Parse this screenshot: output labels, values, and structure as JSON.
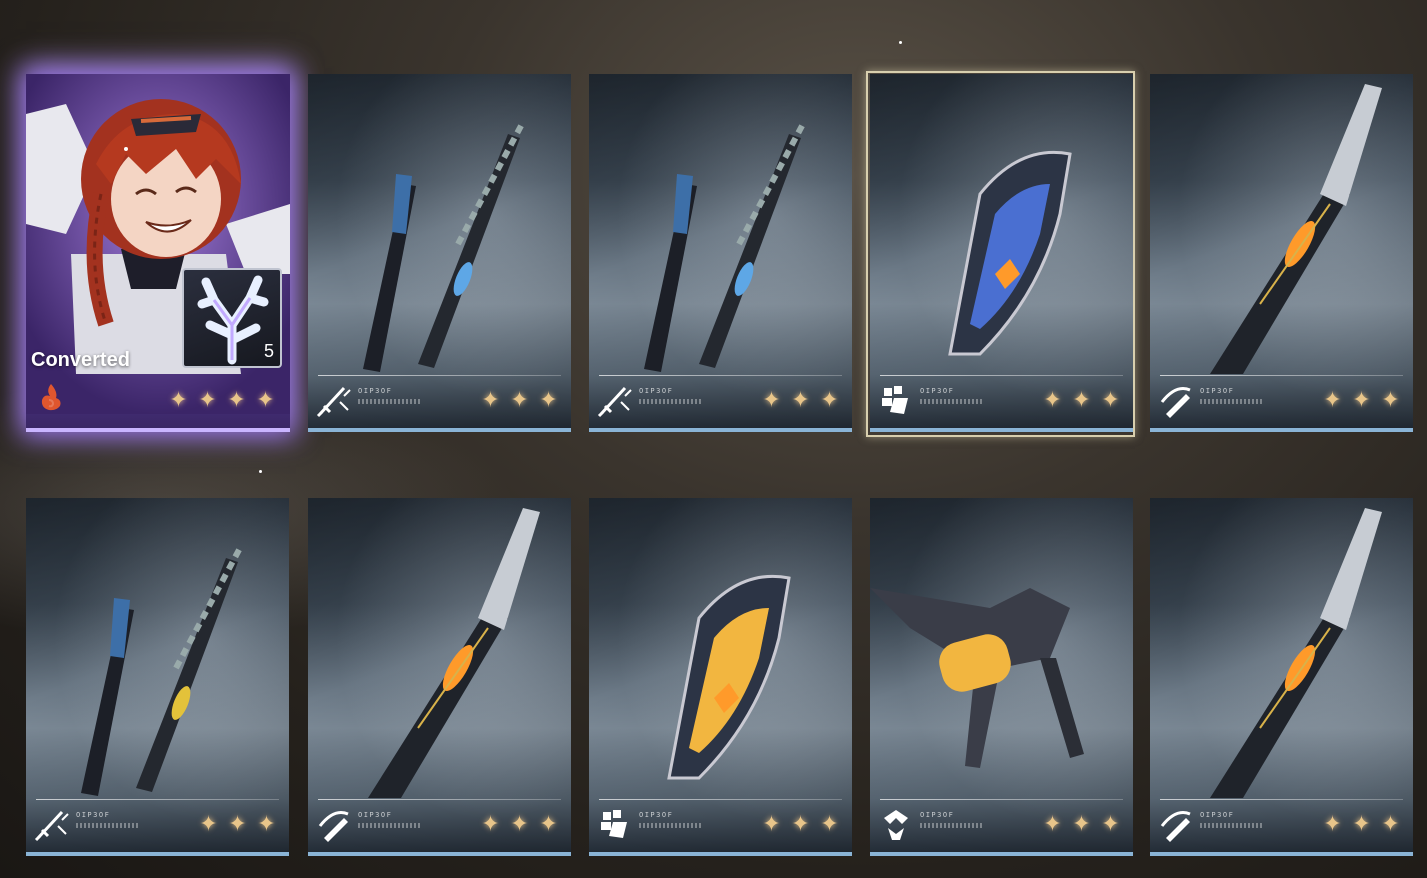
{
  "character": {
    "status_label": "Converted",
    "item_count": "5",
    "rarity": 4,
    "element_icon": "fire-element-icon",
    "item_icon": "coral-crystal-icon"
  },
  "weapons": [
    {
      "type": "sword",
      "type_icon": "sword-type-icon",
      "code": "OIP3OF",
      "rarity": 3,
      "selected": false,
      "accent": "#5ea7e6"
    },
    {
      "type": "sword",
      "type_icon": "sword-type-icon",
      "code": "OIP3OF",
      "rarity": 3,
      "selected": false,
      "accent": "#5ea7e6"
    },
    {
      "type": "gauntlet",
      "type_icon": "gauntlet-type-icon",
      "code": "OIP3OF",
      "rarity": 3,
      "selected": true,
      "accent": "#4a6fd1"
    },
    {
      "type": "broadblade",
      "type_icon": "broadblade-type-icon",
      "code": "OIP3OF",
      "rarity": 3,
      "selected": false,
      "accent": "#ff9a2a"
    },
    {
      "type": "sword",
      "type_icon": "sword-type-icon",
      "code": "OIP3OF",
      "rarity": 3,
      "selected": false,
      "accent": "#e3c23a"
    },
    {
      "type": "broadblade",
      "type_icon": "broadblade-type-icon",
      "code": "OIP3OF",
      "rarity": 3,
      "selected": false,
      "accent": "#ff9a2a"
    },
    {
      "type": "gauntlet",
      "type_icon": "gauntlet-type-icon",
      "code": "OIP3OF",
      "rarity": 3,
      "selected": false,
      "accent": "#f2b640"
    },
    {
      "type": "rectifier",
      "type_icon": "rectifier-type-icon",
      "code": "OIP3OF",
      "rarity": 3,
      "selected": false,
      "accent": "#f2b640"
    },
    {
      "type": "broadblade",
      "type_icon": "broadblade-type-icon",
      "code": "OIP3OF",
      "rarity": 3,
      "selected": false,
      "accent": "#ff9a2a"
    }
  ],
  "star_glyph": "✦"
}
